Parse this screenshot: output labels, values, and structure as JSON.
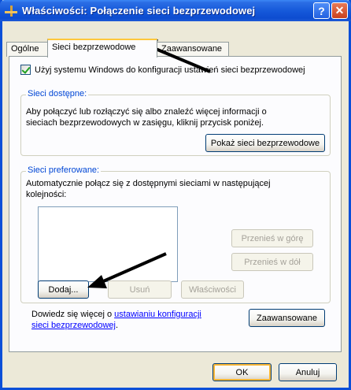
{
  "window": {
    "title": "Właściwości: Połączenie sieci bezprzewodowej",
    "help_glyph": "?",
    "close_glyph": "✕"
  },
  "tabs": [
    {
      "label": "Ogólne",
      "active": false
    },
    {
      "label": "Sieci bezprzewodowe",
      "active": true
    },
    {
      "label": "Zaawansowane",
      "active": false
    }
  ],
  "checkbox": {
    "label": "Użyj systemu Windows do konfiguracji ustawień sieci bezprzewodowej",
    "checked": true
  },
  "available": {
    "title": "Sieci dostępne:",
    "line1": "Aby połączyć lub rozłączyć się albo znaleźć więcej informacji o",
    "line2": "sieciach bezprzewodowych w zasięgu, kliknij przycisk poniżej.",
    "button": "Pokaż sieci bezprzewodowe"
  },
  "preferred": {
    "title": "Sieci preferowane:",
    "line1": "Automatycznie połącz się z dostępnymi sieciami w następującej",
    "line2": "kolejności:",
    "move_up": "Przenieś w górę",
    "move_down": "Przenieś w dół",
    "add": "Dodaj...",
    "remove": "Usuń",
    "properties": "Właściwości"
  },
  "learn_more": {
    "prefix": "Dowiedz się więcej o ",
    "link_part1": "ustawianiu konfiguracji",
    "link_part2": "sieci bezprzewodowej",
    "suffix": ".",
    "advanced_button": "Zaawansowane"
  },
  "footer": {
    "ok": "OK",
    "cancel": "Anuluj"
  },
  "colors": {
    "titlebar": "#0d4cd0",
    "group_label": "#0046d5",
    "link": "#0000ff",
    "dialog_bg": "#ece9d8"
  }
}
